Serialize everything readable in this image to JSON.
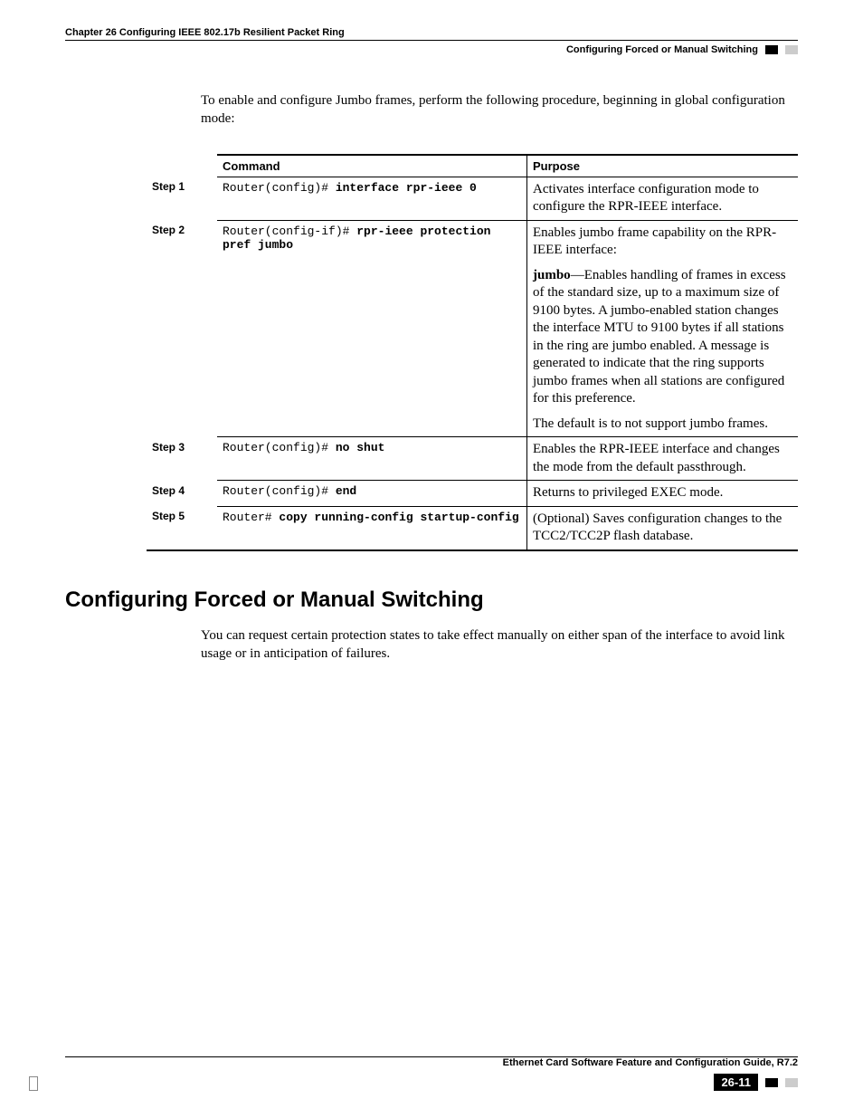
{
  "header": {
    "chapter": "Chapter 26 Configuring IEEE 802.17b Resilient Packet Ring",
    "section": "Configuring Forced or Manual Switching"
  },
  "intro": "To enable and configure Jumbo frames, perform the following procedure, beginning in global configuration mode:",
  "table": {
    "headers": {
      "command": "Command",
      "purpose": "Purpose"
    },
    "rows": [
      {
        "step": "Step 1",
        "prompt": "Router(config)# ",
        "cmd": "interface rpr-ieee 0",
        "purpose": [
          "Activates interface configuration mode to configure the RPR-IEEE interface."
        ]
      },
      {
        "step": "Step 2",
        "prompt": "Router(config-if)# ",
        "cmd": "rpr-ieee protection pref jumbo",
        "purpose_intro": "Enables jumbo frame capability on the RPR-IEEE interface:",
        "purpose_term": "jumbo",
        "purpose_def": "—Enables handling of frames in excess of the standard size, up to a maximum size of 9100 bytes. A jumbo-enabled station changes the interface MTU to 9100 bytes if all stations in the ring are jumbo enabled. A message is generated to indicate that the ring supports jumbo frames when all stations are configured for this preference.",
        "purpose_default": "The default is to not support jumbo frames."
      },
      {
        "step": "Step 3",
        "prompt": "Router(config)# ",
        "cmd": "no shut",
        "purpose": [
          "Enables the RPR-IEEE interface and changes the mode from the default passthrough."
        ]
      },
      {
        "step": "Step 4",
        "prompt": "Router(config)# ",
        "cmd": "end",
        "purpose": [
          "Returns to privileged EXEC mode."
        ]
      },
      {
        "step": "Step 5",
        "prompt": "Router# ",
        "cmd": "copy running-config startup-config",
        "purpose": [
          "(Optional) Saves configuration changes to the TCC2/TCC2P flash database."
        ]
      }
    ]
  },
  "section": {
    "title": "Configuring Forced or Manual Switching",
    "body": "You can request certain protection states to take effect manually on either span of the interface to avoid link usage or in anticipation of failures."
  },
  "footer": {
    "guide": "Ethernet Card Software Feature and Configuration Guide, R7.2",
    "page": "26-11"
  }
}
